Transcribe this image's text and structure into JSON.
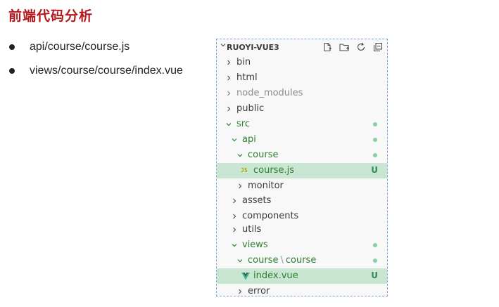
{
  "page": {
    "title": "前端代码分析"
  },
  "bullets": [
    {
      "text": "api/course/course.js"
    },
    {
      "text": "views/course/course/index.vue"
    }
  ],
  "explorer": {
    "header": "RUOYI-VUE3",
    "toolbar_icons": [
      "new-file-icon",
      "new-folder-icon",
      "refresh-icon",
      "collapse-all-icon"
    ],
    "rows": {
      "bin": "bin",
      "html": "html",
      "node_modules": "node_modules",
      "public": "public",
      "src": "src",
      "api": "api",
      "course": "course",
      "course_js_icon": "JS",
      "course_js": "course.js",
      "course_js_badge": "U",
      "monitor": "monitor",
      "assets": "assets",
      "components": "components",
      "utils": "utils",
      "views": "views",
      "views_course": "course",
      "views_course_sep": "\\",
      "views_course_child": "course",
      "index_vue": "index.vue",
      "index_vue_badge": "U",
      "error": "error"
    },
    "colors": {
      "modified": "#73c991",
      "selected_bg": "#c9e6d2",
      "untracked_text": "#2e7d32"
    }
  }
}
